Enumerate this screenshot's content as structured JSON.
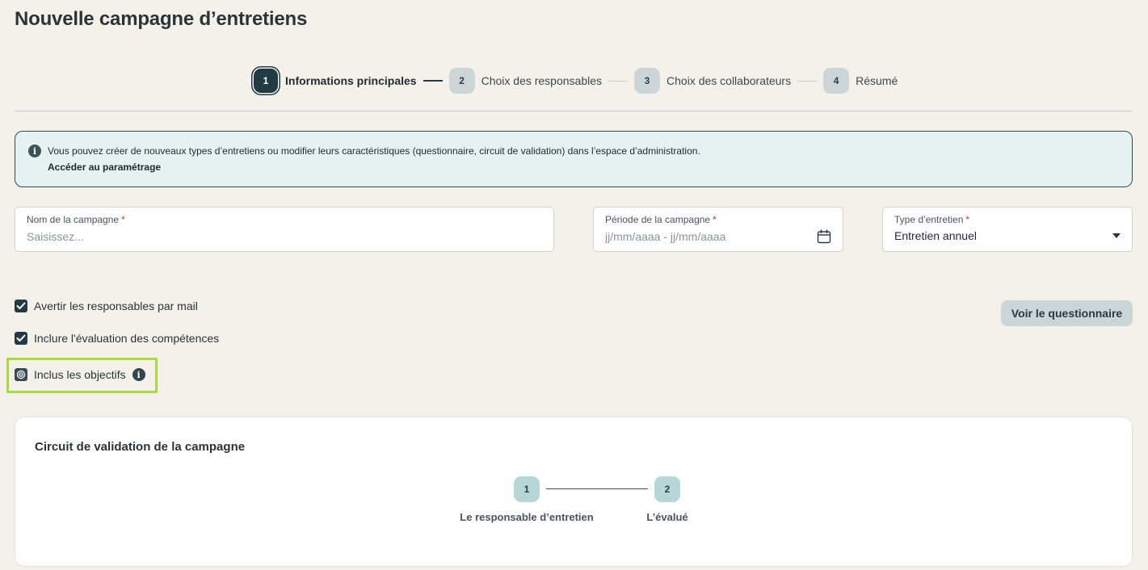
{
  "page": {
    "title": "Nouvelle campagne d’entretiens"
  },
  "stepper": {
    "steps": [
      {
        "number": "1",
        "label": "Informations principales"
      },
      {
        "number": "2",
        "label": "Choix des responsables"
      },
      {
        "number": "3",
        "label": "Choix des collaborateurs"
      },
      {
        "number": "4",
        "label": "Résumé"
      }
    ]
  },
  "info_banner": {
    "text": "Vous pouvez créer de nouveaux types d’entretiens ou modifier leurs caractéristiques (questionnaire, circuit de validation) dans l’espace d’administration.",
    "link": "Accéder au paramétrage"
  },
  "form": {
    "name": {
      "label": "Nom de la campagne",
      "placeholder": "Saisissez...",
      "value": ""
    },
    "period": {
      "label": "Période de la campagne",
      "placeholder": "jj/mm/aaaa - jj/mm/aaaa"
    },
    "type": {
      "label": "Type d’entretien",
      "value": "Entretien annuel"
    },
    "required_mark": "*"
  },
  "options": {
    "notify_managers": "Avertir les responsables par mail",
    "include_skills": "Inclure l'évaluation des compétences",
    "include_objectives": "Inclus les objectifs"
  },
  "actions": {
    "view_questionnaire": "Voir le questionnaire"
  },
  "circuit": {
    "title": "Circuit de validation de la campagne",
    "steps": [
      {
        "number": "1",
        "label": "Le responsable d’entretien"
      },
      {
        "number": "2",
        "label": "L’évalué"
      }
    ]
  },
  "colors": {
    "background": "#f4f1ea",
    "primary": "#243a42",
    "highlight": "#a7dc38",
    "banner_bg": "#e6f1f1",
    "required": "#c7333a"
  }
}
